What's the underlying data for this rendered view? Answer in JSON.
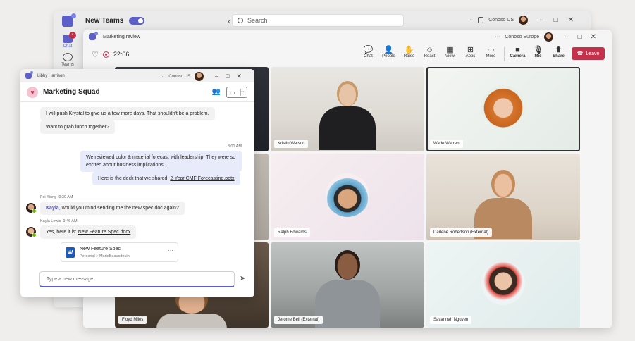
{
  "main_window": {
    "app_toggle_label": "New Teams",
    "search_placeholder": "Search",
    "org": "Conoso US",
    "nav_arrows": "‹  ›",
    "more": "···",
    "rail": {
      "chat_label": "Chat",
      "chat_badge": "4",
      "teams_label": "Teams"
    }
  },
  "meeting_window": {
    "title": "Marketing review",
    "org": "Conoso Europe",
    "timer": "22:06",
    "tools": [
      {
        "label": "Chat",
        "icon": "chat-icon",
        "glyph": "💬"
      },
      {
        "label": "People",
        "icon": "people-icon",
        "glyph": "👤"
      },
      {
        "label": "Raise",
        "icon": "raise-hand-icon",
        "glyph": "✋"
      },
      {
        "label": "React",
        "icon": "react-icon",
        "glyph": "☺"
      },
      {
        "label": "View",
        "icon": "view-icon",
        "glyph": "▦"
      },
      {
        "label": "Apps",
        "icon": "apps-icon",
        "glyph": "⊞"
      },
      {
        "label": "More",
        "icon": "more-icon",
        "glyph": "···"
      }
    ],
    "device_tools": [
      {
        "label": "Camera",
        "icon": "camera-icon",
        "glyph": "■"
      },
      {
        "label": "Mic",
        "icon": "mic-icon",
        "glyph": "🎙"
      },
      {
        "label": "Share",
        "icon": "share-icon",
        "glyph": "⬆"
      }
    ],
    "leave_label": "Leave",
    "participants": [
      {
        "name": "",
        "kind": "video"
      },
      {
        "name": "Kristin Watson",
        "kind": "video"
      },
      {
        "name": "Wade Warren",
        "kind": "avatar"
      },
      {
        "name": "",
        "kind": "video"
      },
      {
        "name": "Ralph Edwards",
        "kind": "avatar"
      },
      {
        "name": "Darlene Robertson (External)",
        "kind": "video"
      },
      {
        "name": "Floyd Miles",
        "kind": "video"
      },
      {
        "name": "Jerome Bell (External)",
        "kind": "video"
      },
      {
        "name": "Savannah Nguyen",
        "kind": "avatar"
      }
    ]
  },
  "chat_window": {
    "title": "Libby Harrison",
    "org": "Conoso US",
    "chat_name": "Marketing Squad",
    "messages": {
      "in_1": "I will push Krystal to give us a few more days. That shouldn't be a problem.",
      "in_2": "Want to grab lunch together?",
      "out_time": "8:01 AM",
      "out_1": "We reviewed color & material forecast with leadership. They were so excited about business implications...",
      "out_2_prefix": "Here is the deck that we shared: ",
      "out_2_link": "2-Year CMF Forecasting.pptx",
      "fei_name": "Fei Xiong",
      "fei_time": "9:30 AM",
      "fei_mention": "Kayla",
      "fei_text": ", would you mind sending me the new spec doc again?",
      "kayla_name": "Kayla Lewis",
      "kayla_time": "9:46 AM",
      "kayla_prefix": "Yes, here it is: ",
      "kayla_link": "New Feature Spec.docx"
    },
    "file_card": {
      "name": "New Feature Spec",
      "path": "Personal > MarieBeausdouin"
    },
    "composer_placeholder": "Type a new message"
  }
}
